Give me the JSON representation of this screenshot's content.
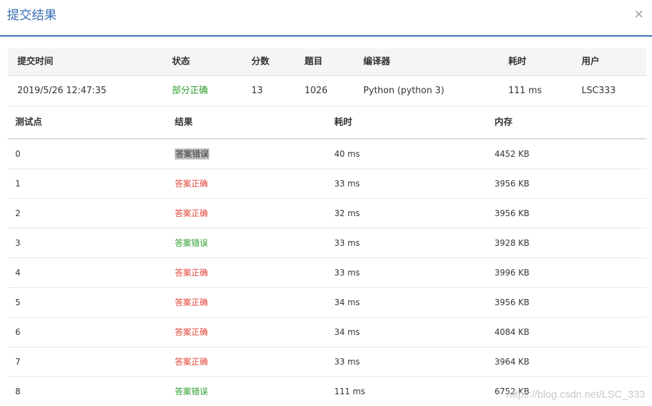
{
  "dialog": {
    "title": "提交结果",
    "close": "×"
  },
  "summary": {
    "headers": {
      "time": "提交时间",
      "status": "状态",
      "score": "分数",
      "problem": "题目",
      "compiler": "编译器",
      "elapsed": "耗时",
      "user": "用户"
    },
    "row": {
      "time": "2019/5/26 12:47:35",
      "status": "部分正确",
      "score": "13",
      "problem": "1026",
      "compiler": "Python (python 3)",
      "elapsed": "111 ms",
      "user": "LSC333"
    },
    "status_color": "#2e9e2e"
  },
  "cases": {
    "headers": {
      "id": "测试点",
      "result": "结果",
      "time": "耗时",
      "memory": "内存"
    },
    "rows": [
      {
        "id": "0",
        "result": "答案错误",
        "time": "40 ms",
        "memory": "4452 KB",
        "color": "#333333",
        "highlight": true
      },
      {
        "id": "1",
        "result": "答案正确",
        "time": "33 ms",
        "memory": "3956 KB",
        "color": "#e0463a",
        "highlight": false
      },
      {
        "id": "2",
        "result": "答案正确",
        "time": "32 ms",
        "memory": "3956 KB",
        "color": "#e0463a",
        "highlight": false
      },
      {
        "id": "3",
        "result": "答案错误",
        "time": "33 ms",
        "memory": "3928 KB",
        "color": "#2e9e2e",
        "highlight": false
      },
      {
        "id": "4",
        "result": "答案正确",
        "time": "33 ms",
        "memory": "3996 KB",
        "color": "#e0463a",
        "highlight": false
      },
      {
        "id": "5",
        "result": "答案正确",
        "time": "34 ms",
        "memory": "3956 KB",
        "color": "#e0463a",
        "highlight": false
      },
      {
        "id": "6",
        "result": "答案正确",
        "time": "34 ms",
        "memory": "4084 KB",
        "color": "#e0463a",
        "highlight": false
      },
      {
        "id": "7",
        "result": "答案正确",
        "time": "33 ms",
        "memory": "3964 KB",
        "color": "#e0463a",
        "highlight": false
      },
      {
        "id": "8",
        "result": "答案错误",
        "time": "111 ms",
        "memory": "6752 KB",
        "color": "#2e9e2e",
        "highlight": false
      }
    ]
  },
  "watermark": "https://blog.csdn.net/LSC_333"
}
